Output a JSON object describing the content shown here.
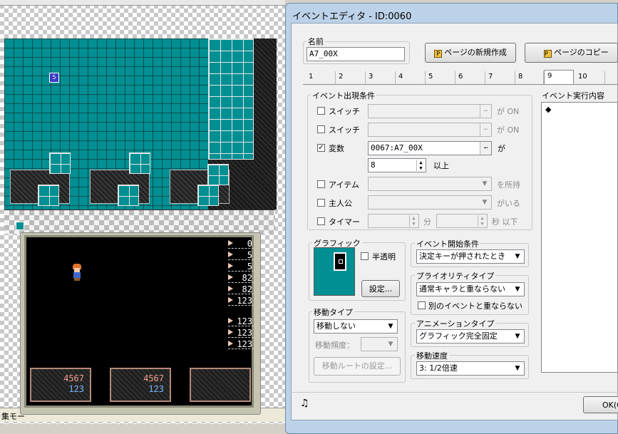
{
  "status_bar": {
    "text": "集モー"
  },
  "map": {
    "event_marker_glyph": "5"
  },
  "preview": {
    "right_values": [
      "0",
      "5",
      "5",
      "82",
      "82",
      "123",
      "123",
      "123",
      "123"
    ],
    "status_boxes": [
      {
        "hp": "4567",
        "mp": "123"
      },
      {
        "hp": "4567",
        "mp": "123"
      },
      {
        "hp": "",
        "mp": ""
      }
    ]
  },
  "dialog": {
    "title": "イベントエディタ - ID:0060",
    "name_label": "名前",
    "name_value": "A7_00X",
    "new_page_button": "ページの新規作成",
    "copy_page_button": "ページのコピー",
    "tabs": [
      "1",
      "2",
      "3",
      "4",
      "5",
      "6",
      "7",
      "8",
      "9",
      "10"
    ],
    "active_tab": "9",
    "conditions": {
      "label": "イベント出現条件",
      "switch1": {
        "label": "スイッチ",
        "checked": false,
        "suffix": "が ON"
      },
      "switch2": {
        "label": "スイッチ",
        "checked": false,
        "suffix": "が ON"
      },
      "variable": {
        "label": "変数",
        "checked": true,
        "value": "0067:A7_00X",
        "suffix": "が",
        "number": "8",
        "compare": "以上"
      },
      "item": {
        "label": "アイテム",
        "checked": false,
        "suffix": "を所持"
      },
      "hero": {
        "label": "主人公",
        "checked": false,
        "suffix": "がいる"
      },
      "timer": {
        "label": "タイマー",
        "checked": false,
        "min_unit": "分",
        "sec_unit": "秒 以下"
      }
    },
    "graphic": {
      "label": "グラフィック",
      "transparent_label": "半透明",
      "settings_button": "設定..."
    },
    "movement": {
      "label": "移動タイプ",
      "type_value": "移動しない",
      "freq_label": "移動頻度：",
      "route_button": "移動ルートの設定..."
    },
    "trigger": {
      "label": "イベント開始条件",
      "value": "決定キーが押されたとき"
    },
    "priority": {
      "label": "プライオリティタイプ",
      "value": "通常キャラと重ならない",
      "no_overlap_label": "別のイベントと重ならない"
    },
    "animation": {
      "label": "アニメーションタイプ",
      "value": "グラフィック完全固定"
    },
    "speed": {
      "label": "移動速度",
      "value": "3: 1/2倍速"
    },
    "exec": {
      "label": "イベント実行内容",
      "first_item": "◆"
    },
    "ok_button": "OK(O"
  },
  "colors": {
    "teal": "#008f92",
    "dialog_frame": "#bcd2e8"
  }
}
